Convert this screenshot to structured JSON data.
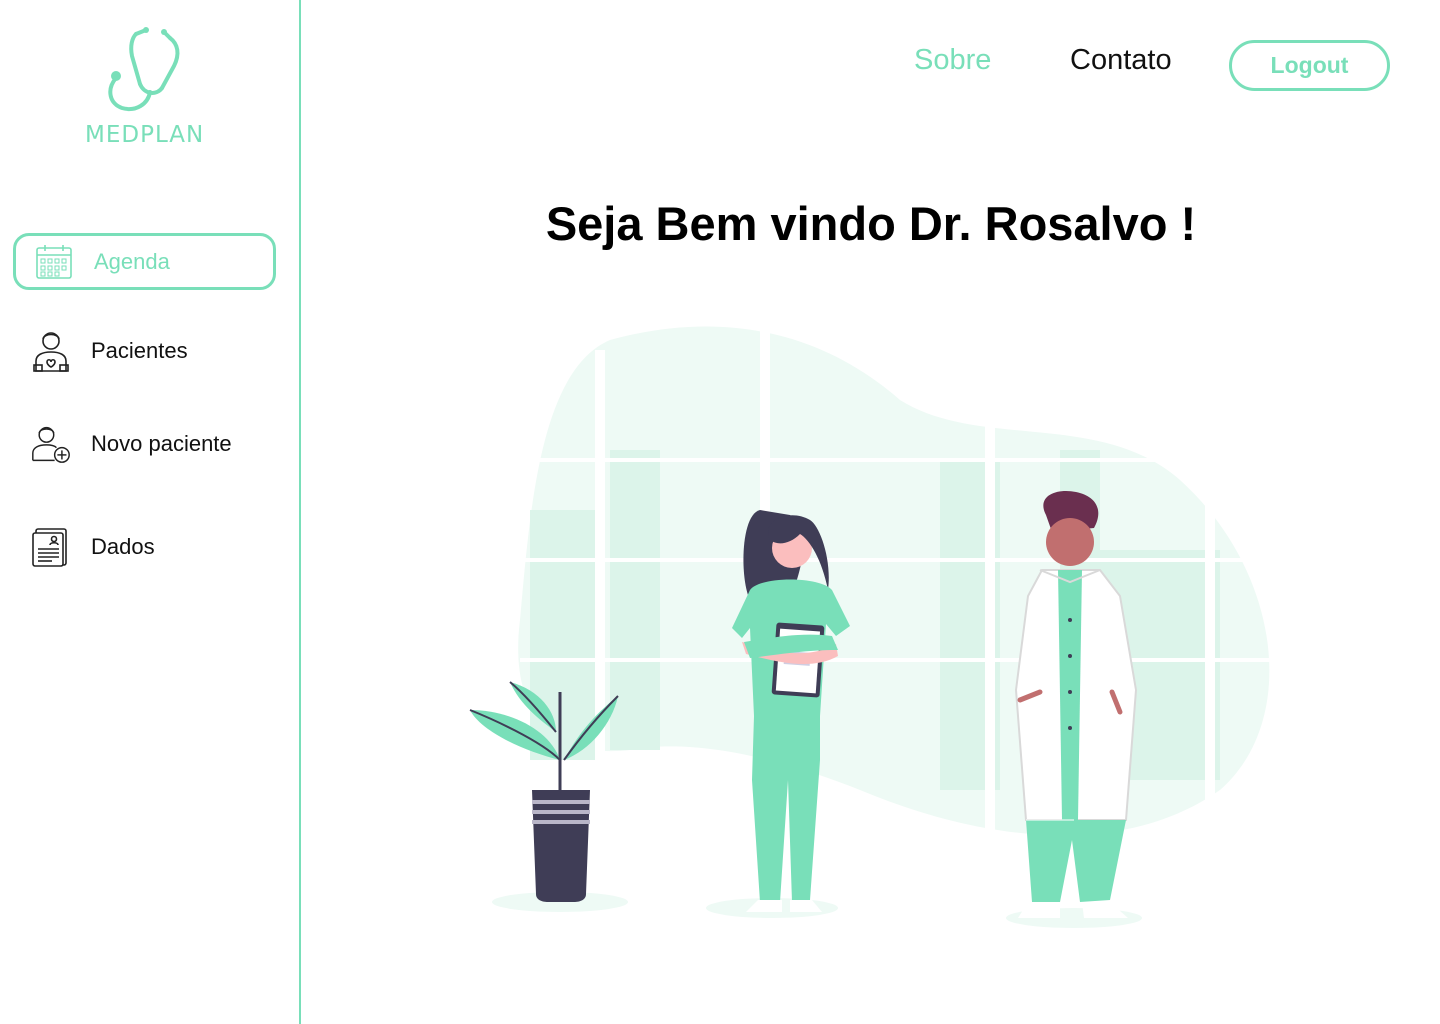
{
  "brand": {
    "name": "MEDPLAN",
    "icon": "stethoscope-icon",
    "color": "#79dfb9"
  },
  "sidebar": {
    "items": [
      {
        "label": "Agenda",
        "icon": "calendar-icon",
        "active": true
      },
      {
        "label": "Pacientes",
        "icon": "patient-icon",
        "active": false
      },
      {
        "label": "Novo paciente",
        "icon": "add-patient-icon",
        "active": false
      },
      {
        "label": "Dados",
        "icon": "document-icon",
        "active": false
      }
    ]
  },
  "header": {
    "links": [
      {
        "label": "Sobre",
        "active": true
      },
      {
        "label": "Contato",
        "active": false
      }
    ],
    "logout_label": "Logout"
  },
  "main": {
    "welcome": "Seja Bem vindo Dr. Rosalvo !",
    "illustration": "doctors-illustration"
  },
  "colors": {
    "accent": "#79dfb9",
    "text": "#111111",
    "background": "#ffffff"
  }
}
